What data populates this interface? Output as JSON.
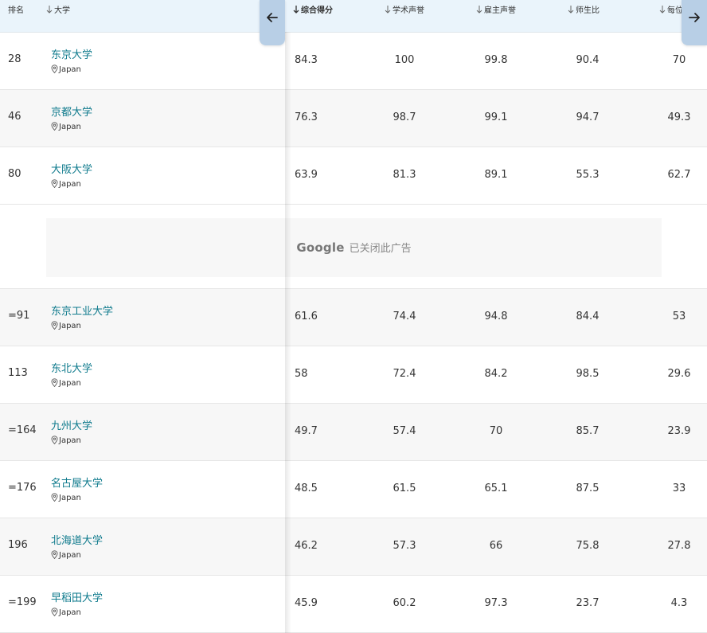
{
  "header": {
    "columns": [
      {
        "key": "rank",
        "label": "排名"
      },
      {
        "key": "name",
        "label": "大学"
      },
      {
        "key": "overall",
        "label": "综合得分"
      },
      {
        "key": "academic",
        "label": "学术声誉"
      },
      {
        "key": "employer",
        "label": "雇主声誉"
      },
      {
        "key": "faculty",
        "label": "师生比"
      },
      {
        "key": "citations",
        "label": "每位"
      }
    ]
  },
  "icons": {
    "sort": "arrow-down-icon",
    "prev": "arrow-left-icon",
    "next": "arrow-right-icon",
    "location": "map-pin-icon"
  },
  "colors": {
    "header_bg": "#eaf4fb",
    "nav_button": "#b8cfe6",
    "link": "#0e7a8c",
    "row_alt": "#f7f7f7"
  },
  "rows": [
    {
      "rank": "28",
      "name": "东京大学",
      "country": "Japan",
      "overall": "84.3",
      "academic": "100",
      "employer": "99.8",
      "faculty": "90.4",
      "citations": "70"
    },
    {
      "rank": "46",
      "name": "京都大学",
      "country": "Japan",
      "overall": "76.3",
      "academic": "98.7",
      "employer": "99.1",
      "faculty": "94.7",
      "citations": "49.3"
    },
    {
      "rank": "80",
      "name": "大阪大学",
      "country": "Japan",
      "overall": "63.9",
      "academic": "81.3",
      "employer": "89.1",
      "faculty": "55.3",
      "citations": "62.7"
    },
    {
      "rank": "=91",
      "name": "东京工业大学",
      "country": "Japan",
      "overall": "61.6",
      "academic": "74.4",
      "employer": "94.8",
      "faculty": "84.4",
      "citations": "53"
    },
    {
      "rank": "113",
      "name": "东北大学",
      "country": "Japan",
      "overall": "58",
      "academic": "72.4",
      "employer": "84.2",
      "faculty": "98.5",
      "citations": "29.6"
    },
    {
      "rank": "=164",
      "name": "九州大学",
      "country": "Japan",
      "overall": "49.7",
      "academic": "57.4",
      "employer": "70",
      "faculty": "85.7",
      "citations": "23.9"
    },
    {
      "rank": "=176",
      "name": "名古屋大学",
      "country": "Japan",
      "overall": "48.5",
      "academic": "61.5",
      "employer": "65.1",
      "faculty": "87.5",
      "citations": "33"
    },
    {
      "rank": "196",
      "name": "北海道大学",
      "country": "Japan",
      "overall": "46.2",
      "academic": "57.3",
      "employer": "66",
      "faculty": "75.8",
      "citations": "27.8"
    },
    {
      "rank": "=199",
      "name": "早稻田大学",
      "country": "Japan",
      "overall": "45.9",
      "academic": "60.2",
      "employer": "97.3",
      "faculty": "23.7",
      "citations": "4.3"
    }
  ],
  "ad": {
    "brand": "Google",
    "message": "已关闭此广告"
  }
}
